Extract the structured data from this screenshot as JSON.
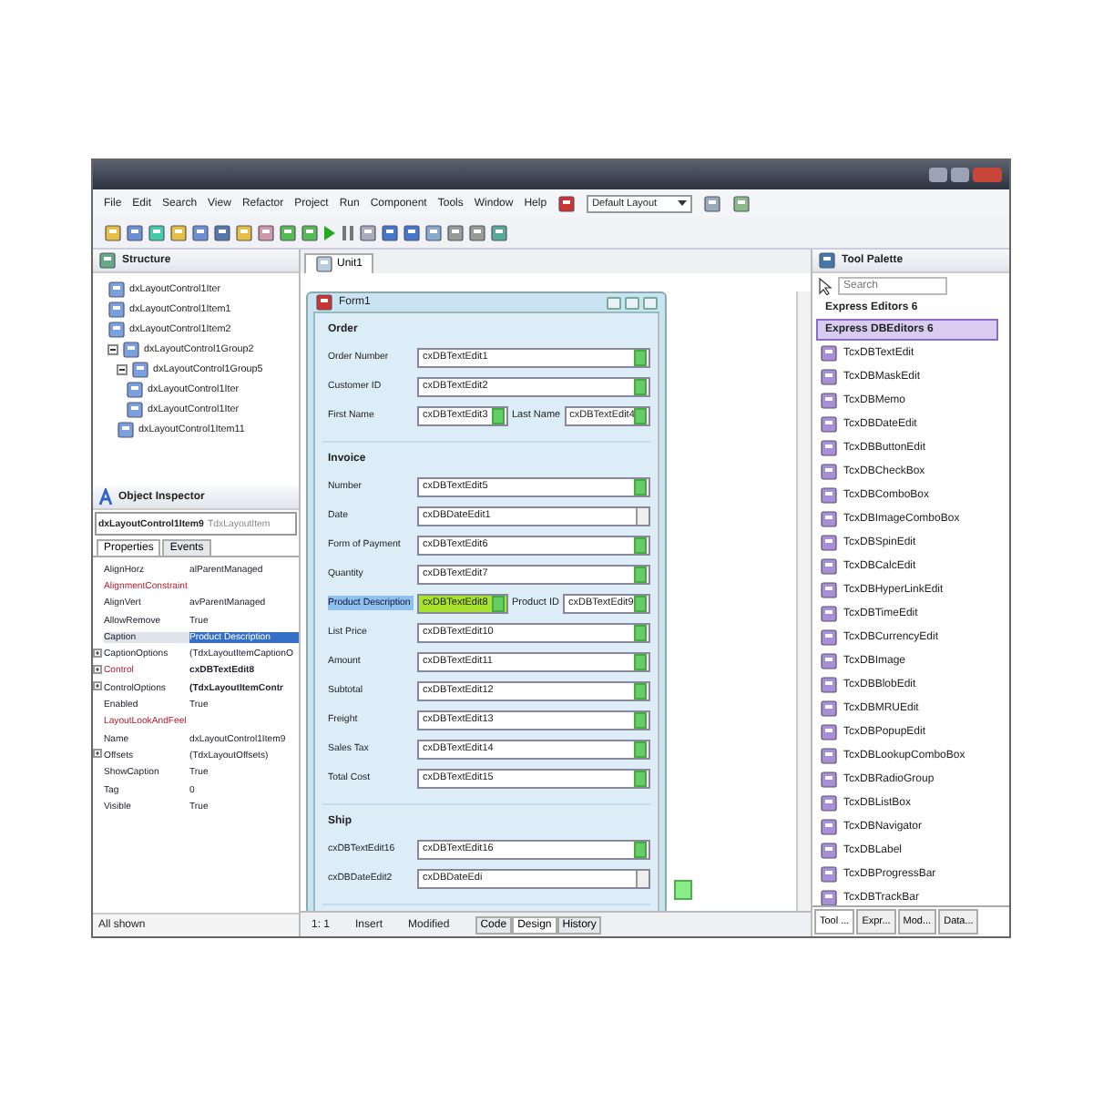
{
  "menu": {
    "items": [
      "File",
      "Edit",
      "Search",
      "View",
      "Refactor",
      "Project",
      "Run",
      "Component",
      "Tools",
      "Window",
      "Help"
    ],
    "layout": "Default Layout"
  },
  "structure": {
    "title": "Structure",
    "tree": [
      {
        "label": "dxLayoutControl1Iter"
      },
      {
        "label": "dxLayoutControl1Item1"
      },
      {
        "label": "dxLayoutControl1Item2"
      },
      {
        "label": "dxLayoutControl1Group2",
        "expanded": true,
        "children": [
          {
            "label": "dxLayoutControl1Group5",
            "expanded": true,
            "children": [
              {
                "label": "dxLayoutControl1Iter"
              },
              {
                "label": "dxLayoutControl1Iter"
              }
            ]
          },
          {
            "label": "dxLayoutControl1Item11"
          }
        ]
      }
    ]
  },
  "inspector": {
    "title": "Object Inspector",
    "object": "dxLayoutControl1Item9",
    "object_type": "TdxLayoutItem",
    "tabs": [
      {
        "label": "Properties",
        "selected": true
      },
      {
        "label": "Events",
        "selected": false
      }
    ],
    "properties": [
      {
        "name": "AlignHorz",
        "value": "alParentManaged",
        "expandable": false,
        "reference": false,
        "bold": false,
        "selected": false
      },
      {
        "name": "AlignmentConstraint",
        "expandable": false,
        "reference": true,
        "selected": false
      },
      {
        "name": "AlignVert",
        "value": "avParentManaged",
        "expandable": false,
        "reference": false,
        "bold": false,
        "selected": false
      },
      {
        "name": "AllowRemove",
        "value": "True",
        "expandable": false,
        "reference": false,
        "bold": false,
        "selected": false
      },
      {
        "name": "Caption",
        "value": "Product Description",
        "expandable": false,
        "reference": false,
        "bold": false,
        "selected": true
      },
      {
        "name": "CaptionOptions",
        "value": "(TdxLayoutItemCaptionO",
        "expandable": true,
        "reference": false,
        "bold": false,
        "selected": false
      },
      {
        "name": "Control",
        "value": "cxDBTextEdit8",
        "expandable": true,
        "reference": true,
        "bold": true,
        "selected": false
      },
      {
        "name": "ControlOptions",
        "value": "(TdxLayoutItemContr",
        "expandable": true,
        "reference": false,
        "bold": true,
        "selected": false
      },
      {
        "name": "Enabled",
        "value": "True",
        "expandable": false,
        "reference": false,
        "bold": false,
        "selected": false
      },
      {
        "name": "LayoutLookAndFeel",
        "expandable": false,
        "reference": true,
        "selected": false
      },
      {
        "name": "Name",
        "value": "dxLayoutControl1Item9",
        "expandable": false,
        "reference": false,
        "bold": false,
        "selected": false
      },
      {
        "name": "Offsets",
        "value": "(TdxLayoutOffsets)",
        "expandable": true,
        "reference": false,
        "bold": false,
        "selected": false
      },
      {
        "name": "ShowCaption",
        "value": "True",
        "expandable": false,
        "reference": false,
        "bold": false,
        "selected": false
      },
      {
        "name": "Tag",
        "value": "0",
        "expandable": false,
        "reference": false,
        "bold": false,
        "selected": false
      },
      {
        "name": "Visible",
        "value": "True",
        "expandable": false,
        "reference": false,
        "bold": false,
        "selected": false
      }
    ],
    "status": "All shown"
  },
  "editor": {
    "tab": "Unit1",
    "form": {
      "title": "Form1",
      "groups": [
        {
          "title": "Order",
          "rows": [
            {
              "label": "Order Number",
              "kind": "text",
              "value": "cxDBTextEdit1",
              "selected": false
            },
            {
              "label": "Customer ID",
              "kind": "text",
              "value": "cxDBTextEdit2",
              "selected": false
            },
            {
              "label": "First Name",
              "kind": "pair",
              "value": "cxDBTextEdit3",
              "second_label": "Last Name",
              "second_value": "cxDBTextEdit4",
              "selected": false
            }
          ]
        },
        {
          "title": "Invoice",
          "rows": [
            {
              "label": "Number",
              "kind": "text",
              "value": "cxDBTextEdit5",
              "selected": false
            },
            {
              "label": "Date",
              "kind": "date",
              "value": "cxDBDateEdit1",
              "selected": false
            },
            {
              "label": "Form of Payment",
              "kind": "text",
              "value": "cxDBTextEdit6",
              "selected": false
            },
            {
              "label": "Quantity",
              "kind": "text",
              "value": "cxDBTextEdit7",
              "selected": false
            },
            {
              "label": "Product Description",
              "kind": "pair",
              "value": "cxDBTextEdit8",
              "second_label": "Product ID",
              "second_value": "cxDBTextEdit9",
              "selected": true
            },
            {
              "label": "List Price",
              "kind": "text",
              "value": "cxDBTextEdit10",
              "selected": false
            },
            {
              "label": "Amount",
              "kind": "text",
              "value": "cxDBTextEdit11",
              "selected": false
            },
            {
              "label": "Subtotal",
              "kind": "text",
              "value": "cxDBTextEdit12",
              "selected": false
            },
            {
              "label": "Freight",
              "kind": "text",
              "value": "cxDBTextEdit13",
              "selected": false
            },
            {
              "label": "Sales Tax",
              "kind": "text",
              "value": "cxDBTextEdit14",
              "selected": false
            },
            {
              "label": "Total Cost",
              "kind": "text",
              "value": "cxDBTextEdit15",
              "selected": false
            }
          ]
        },
        {
          "title": "Ship",
          "rows": [
            {
              "label": "cxDBTextEdit16",
              "kind": "text",
              "value": "cxDBTextEdit16",
              "selected": false
            },
            {
              "label": "cxDBDateEdit2",
              "kind": "date",
              "value": "cxDBDateEdi",
              "selected": false
            }
          ]
        }
      ]
    },
    "status": {
      "position": "1: 1",
      "mode": "Insert",
      "state": "Modified",
      "tabs": [
        {
          "label": "Code",
          "selected": false
        },
        {
          "label": "Design",
          "selected": true
        },
        {
          "label": "History",
          "selected": false
        }
      ]
    }
  },
  "palette": {
    "title": "Tool Palette",
    "search_placeholder": "Search",
    "categories": [
      {
        "label": "Express Editors 6",
        "selected": false
      },
      {
        "label": "Express DBEditors 6",
        "selected": true
      }
    ],
    "items": [
      "TcxDBTextEdit",
      "TcxDBMaskEdit",
      "TcxDBMemo",
      "TcxDBDateEdit",
      "TcxDBButtonEdit",
      "TcxDBCheckBox",
      "TcxDBComboBox",
      "TcxDBImageComboBox",
      "TcxDBSpinEdit",
      "TcxDBCalcEdit",
      "TcxDBHyperLinkEdit",
      "TcxDBTimeEdit",
      "TcxDBCurrencyEdit",
      "TcxDBImage",
      "TcxDBBlobEdit",
      "TcxDBMRUEdit",
      "TcxDBPopupEdit",
      "TcxDBLookupComboBox",
      "TcxDBRadioGroup",
      "TcxDBListBox",
      "TcxDBNavigator",
      "TcxDBLabel",
      "TcxDBProgressBar",
      "TcxDBTrackBar"
    ],
    "tabs": [
      {
        "label": "Tool ...",
        "selected": true
      },
      {
        "label": "Expr...",
        "selected": false
      },
      {
        "label": "Mod...",
        "selected": false
      },
      {
        "label": "Data...",
        "selected": false
      }
    ]
  }
}
